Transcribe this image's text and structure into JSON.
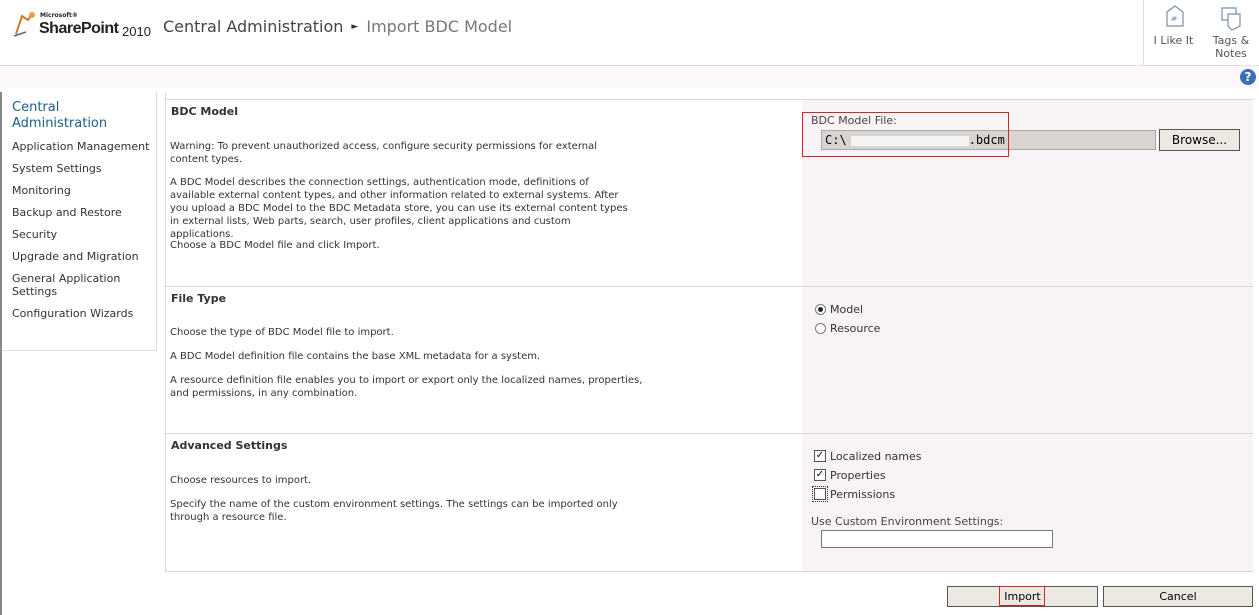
{
  "header": {
    "logo_microsoft": "Microsoft®",
    "logo_product": "SharePoint",
    "logo_year": "2010",
    "breadcrumb": [
      "Central Administration",
      "Import BDC Model"
    ],
    "social": {
      "like_label": "I Like It",
      "tags_label_1": "Tags &",
      "tags_label_2": "Notes"
    },
    "help": "?"
  },
  "leftnav": {
    "title": "Central Administration",
    "items": [
      "Application Management",
      "System Settings",
      "Monitoring",
      "Backup and Restore",
      "Security",
      "Upgrade and Migration",
      "General Application Settings",
      "Configuration Wizards"
    ]
  },
  "sections": {
    "bdc_model": {
      "title": "BDC Model",
      "warning": "Warning: To prevent unauthorized access, configure security permissions for external content types.",
      "description": "A BDC Model describes the connection settings, authentication mode, definitions of available external content types, and other information related to external systems. After you upload a BDC Model to the BDC Metadata store, you can use its external content types in external lists, Web parts, search, user profiles, client applications and custom applications.",
      "instruction": "Choose a BDC Model file and click Import.",
      "file_label": "BDC Model File:",
      "file_value_prefix": "C:\\",
      "file_value_suffix": ".bdcm",
      "browse_label": "Browse..."
    },
    "file_type": {
      "title": "File Type",
      "line1": "Choose the type of BDC Model file to import.",
      "line2": "A BDC Model definition file contains the base XML metadata for a system.",
      "line3": "A resource definition file enables you to import or export only the localized names, properties, and permissions, in any combination.",
      "options": [
        "Model",
        "Resource"
      ],
      "selected": "Model"
    },
    "advanced": {
      "title": "Advanced Settings",
      "line1": "Choose resources to import.",
      "line2": "Specify the name of the custom environment settings. The settings can be imported only through a resource file.",
      "checkboxes": [
        {
          "label": "Localized names",
          "checked": true
        },
        {
          "label": "Properties",
          "checked": true
        },
        {
          "label": "Permissions",
          "checked": false
        }
      ],
      "env_label": "Use Custom Environment Settings:",
      "env_value": ""
    }
  },
  "actions": {
    "import_label": "Import",
    "cancel_label": "Cancel"
  },
  "colors": {
    "nav_title": "#1f5d8c",
    "highlight": "#dd2222",
    "right_panel": "#f7f3f6"
  }
}
